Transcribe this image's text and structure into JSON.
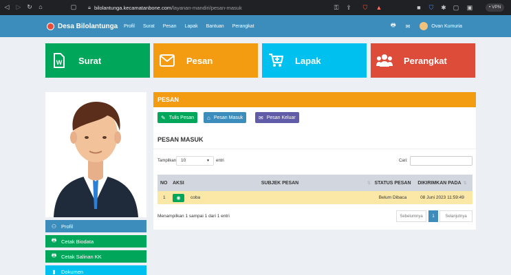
{
  "browser": {
    "url_host": "bilolantunga.kecamatanbone.com",
    "url_path": "/layanan-mandiri/pesan-masuk",
    "vpn_label": "• VPN"
  },
  "header": {
    "brand": "Desa Bilolantunga",
    "nav": [
      "Profil",
      "Surat",
      "Pesan",
      "Lapak",
      "Bantuan",
      "Perangkat"
    ],
    "user_name": "Ovan Kumuria"
  },
  "tiles": [
    {
      "label": "Surat",
      "color": "#00a65a",
      "icon": "document-w-icon"
    },
    {
      "label": "Pesan",
      "color": "#f39c12",
      "icon": "envelope-icon"
    },
    {
      "label": "Lapak",
      "color": "#00c0ef",
      "icon": "cart-icon"
    },
    {
      "label": "Perangkat",
      "color": "#dd4b39",
      "icon": "users-icon"
    }
  ],
  "sidebar": {
    "items": [
      {
        "label": "Profil",
        "icon": "user-icon"
      },
      {
        "label": "Cetak Biodata",
        "icon": "print-icon"
      },
      {
        "label": "Cetak Salinan KK",
        "icon": "print-icon"
      },
      {
        "label": "Dokumen",
        "icon": "file-icon"
      }
    ]
  },
  "panel": {
    "title": "PESAN",
    "buttons": [
      {
        "label": "Tulis Pesan",
        "icon": "edit-icon"
      },
      {
        "label": "Pesan Masuk",
        "icon": "inbox-icon"
      },
      {
        "label": "Pesan Keluar",
        "icon": "envelope-icon"
      }
    ],
    "section_title": "PESAN MASUK",
    "length_label": "Tampilkan",
    "length_value": "10",
    "length_suffix": "entri",
    "search_label": "Cari:",
    "table": {
      "headers": [
        "NO",
        "AKSI",
        "SUBJEK PESAN",
        "STATUS PESAN",
        "DIKIRIMKAN PADA"
      ],
      "rows": [
        {
          "no": "1",
          "subject": "coba",
          "status": "Belum Dibaca",
          "date": "08 Juni 2023 11:59:49"
        }
      ]
    },
    "info": "Menampilkan 1 sampai 1 dari 1 entri",
    "pager": {
      "prev": "Sebelumnya",
      "current": "1",
      "next": "Selanjutnya"
    }
  }
}
